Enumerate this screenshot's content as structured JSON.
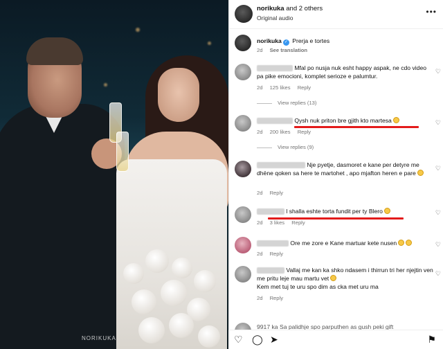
{
  "header": {
    "username": "norikuka",
    "and_others": "and 2 others",
    "audio": "Original audio",
    "more_icon": "more-horizontal-icon"
  },
  "caption": {
    "username": "norikuka",
    "text": "Prerja e tortes",
    "age": "2d",
    "translate": "See translation"
  },
  "comments": [
    {
      "text": "Mfal po nusja nuk esht happy aspak, ne cdo video pa pike emocioni, komplet serioze e palumtur.",
      "age": "2d",
      "likes": "125 likes",
      "reply": "Reply",
      "view_replies": "View replies (13)"
    },
    {
      "text": "Qysh nuk priton bre gjith kto martesa",
      "age": "2d",
      "likes": "200 likes",
      "reply": "Reply",
      "view_replies": "View replies (9)"
    },
    {
      "text": "Nje pyetje, dasmoret e kane per detyre me dhëne qoken sa here te martohet , apo mjafton heren e pare",
      "age": "2d",
      "likes": "",
      "reply": "Reply"
    },
    {
      "text": "l shalla eshte torta fundit per ty Blero",
      "age": "2d",
      "likes": "3 likes",
      "reply": "Reply"
    },
    {
      "text": "Ore me zore e Kane martuar kete nusen",
      "age": "2d",
      "likes": "",
      "reply": "Reply"
    },
    {
      "text": "Vallaj me kan ka shko ndasem i thirrun tri her njejtin ven me pritu leje mau martu vet",
      "text2": "Kem met tuj te uru spo dim as cka met uru ma",
      "age": "2d",
      "likes": "",
      "reply": "Reply"
    },
    {
      "text": "9917 ka Sa palidhje spo parputhen as gush peki gift"
    }
  ],
  "watermark": "NORIKUKA",
  "colors": {
    "accent_red": "#e31b1b",
    "verified_blue": "#3897f0",
    "meta_grey": "#737373"
  },
  "actions": [
    "heart-icon",
    "comment-icon",
    "share-icon",
    "save-icon"
  ]
}
